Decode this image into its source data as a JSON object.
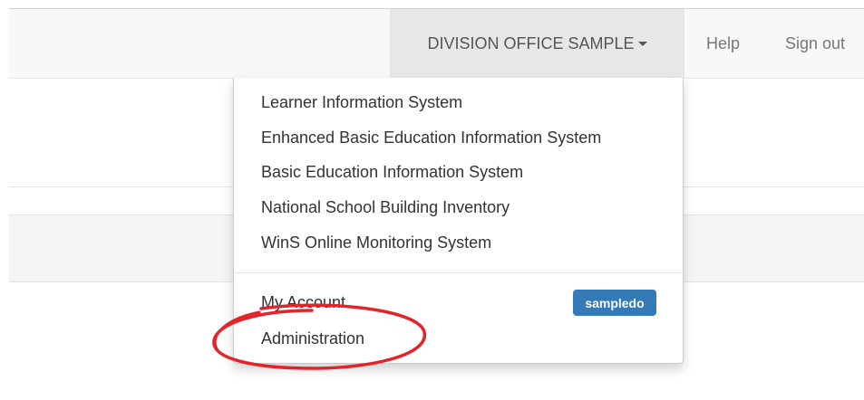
{
  "navbar": {
    "office_dropdown_label": "DIVISION OFFICE SAMPLE",
    "help_label": "Help",
    "signout_label": "Sign out"
  },
  "dropdown": {
    "systems": [
      {
        "label": "Learner Information System"
      },
      {
        "label": "Enhanced Basic Education Information System"
      },
      {
        "label": "Basic Education Information System"
      },
      {
        "label": "National School Building Inventory"
      },
      {
        "label": "WinS Online Monitoring System"
      }
    ],
    "account_label": "My Account",
    "username_badge": "sampledo",
    "administration_label": "Administration"
  },
  "colors": {
    "badge": "#337ab7",
    "annotation": "#e3242b"
  },
  "icons": {
    "dropdown_caret": "caret-down-icon"
  }
}
